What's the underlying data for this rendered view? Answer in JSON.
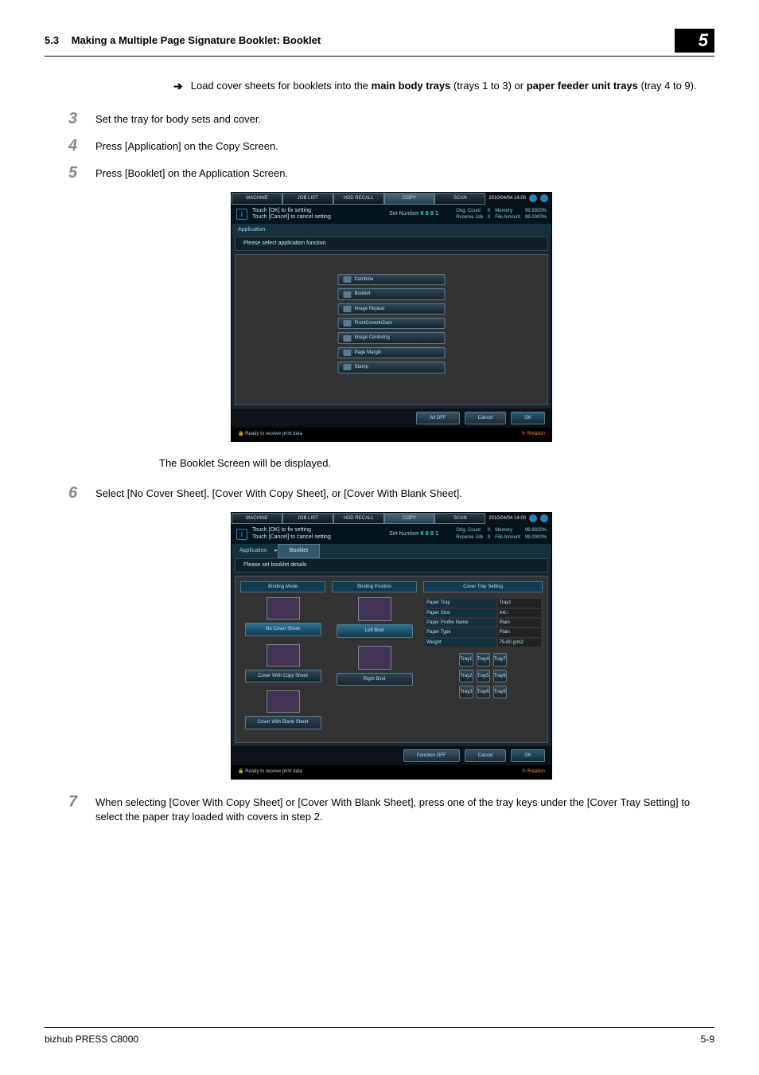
{
  "header": {
    "section_number": "5.3",
    "section_title": "Making a Multiple Page Signature Booklet: Booklet",
    "chapter": "5"
  },
  "intro_arrow": {
    "text_a": "Load cover sheets for booklets into the ",
    "bold_a": "main body trays",
    "text_b": " (trays 1 to 3) or ",
    "bold_b": "paper feeder unit trays",
    "text_c": " (tray 4 to 9)."
  },
  "steps": {
    "s3": "Set the tray for body sets and cover.",
    "s4": "Press [Application] on the Copy Screen.",
    "s5": "Press [Booklet] on the Application Screen.",
    "after5": "The Booklet Screen will be displayed.",
    "s6": "Select [No Cover Sheet], [Cover With Copy Sheet], or [Cover With Blank Sheet].",
    "s7": "When selecting [Cover With Copy Sheet] or [Cover With Blank Sheet], press one of the tray keys under the [Cover Tray Setting] to select the paper tray loaded with covers in step 2."
  },
  "screens": {
    "tabs": [
      "MACHINE",
      "JOB LIST",
      "HDD RECALL",
      "COPY",
      "SCAN"
    ],
    "datetime": "2010/04/04 14:00",
    "msg1": "Touch [OK] to fix setting",
    "msg2": "Touch [Cancel] to cancel setting",
    "setnum_label": "Set Number",
    "setnum_val": "0001",
    "status_orig": "Orig. Count",
    "status_orig_v": "0",
    "status_res": "Reserve Job",
    "status_res_v": "0",
    "status_mem": "Memory",
    "status_mem_v": "99.9920%",
    "status_file": "File Amount",
    "status_file_v": "99.0000%",
    "s1": {
      "appbar": "Application",
      "subbar": "Please select application function",
      "menu": [
        "Combine",
        "Booklet",
        "Image Repeat",
        "FrontCoverInDark",
        "Image Centering",
        "Page Margin",
        "Stamp"
      ],
      "btns": [
        "All OFF",
        "Cancel",
        "OK"
      ]
    },
    "s2": {
      "crumb_a": "Application",
      "crumb_b": "Booklet",
      "subbar": "Please set booklet details",
      "col1_head": "Binding Mode",
      "col1_opts": [
        "No Cover Sheet",
        "Cover With Copy Sheet",
        "Cover With Blank Sheet"
      ],
      "col2_head": "Binding Position",
      "col2_opts": [
        "Left Bind",
        "Right Bind"
      ],
      "col3_head": "Cover Tray Setting",
      "table": {
        "r1l": "Paper Tray",
        "r1v": "Tray1",
        "r2l": "Paper Size",
        "r2v": "A4□",
        "r3l": "Paper Profile Name",
        "r3v": "Plain",
        "r4l": "Paper Type",
        "r4v": "Plain",
        "r5l": "Weight",
        "r5v": "75-80 g/m2"
      },
      "trays": [
        "Tray1",
        "Tray4",
        "Tray7",
        "Tray2",
        "Tray5",
        "Tray8",
        "Tray3",
        "Tray6",
        "Tray9"
      ],
      "btns": [
        "Function OFF",
        "Cancel",
        "OK"
      ]
    },
    "foot_ready": "Ready to receive print data",
    "foot_rot": "Rotation"
  },
  "footer": {
    "product": "bizhub PRESS C8000",
    "page": "5-9"
  }
}
